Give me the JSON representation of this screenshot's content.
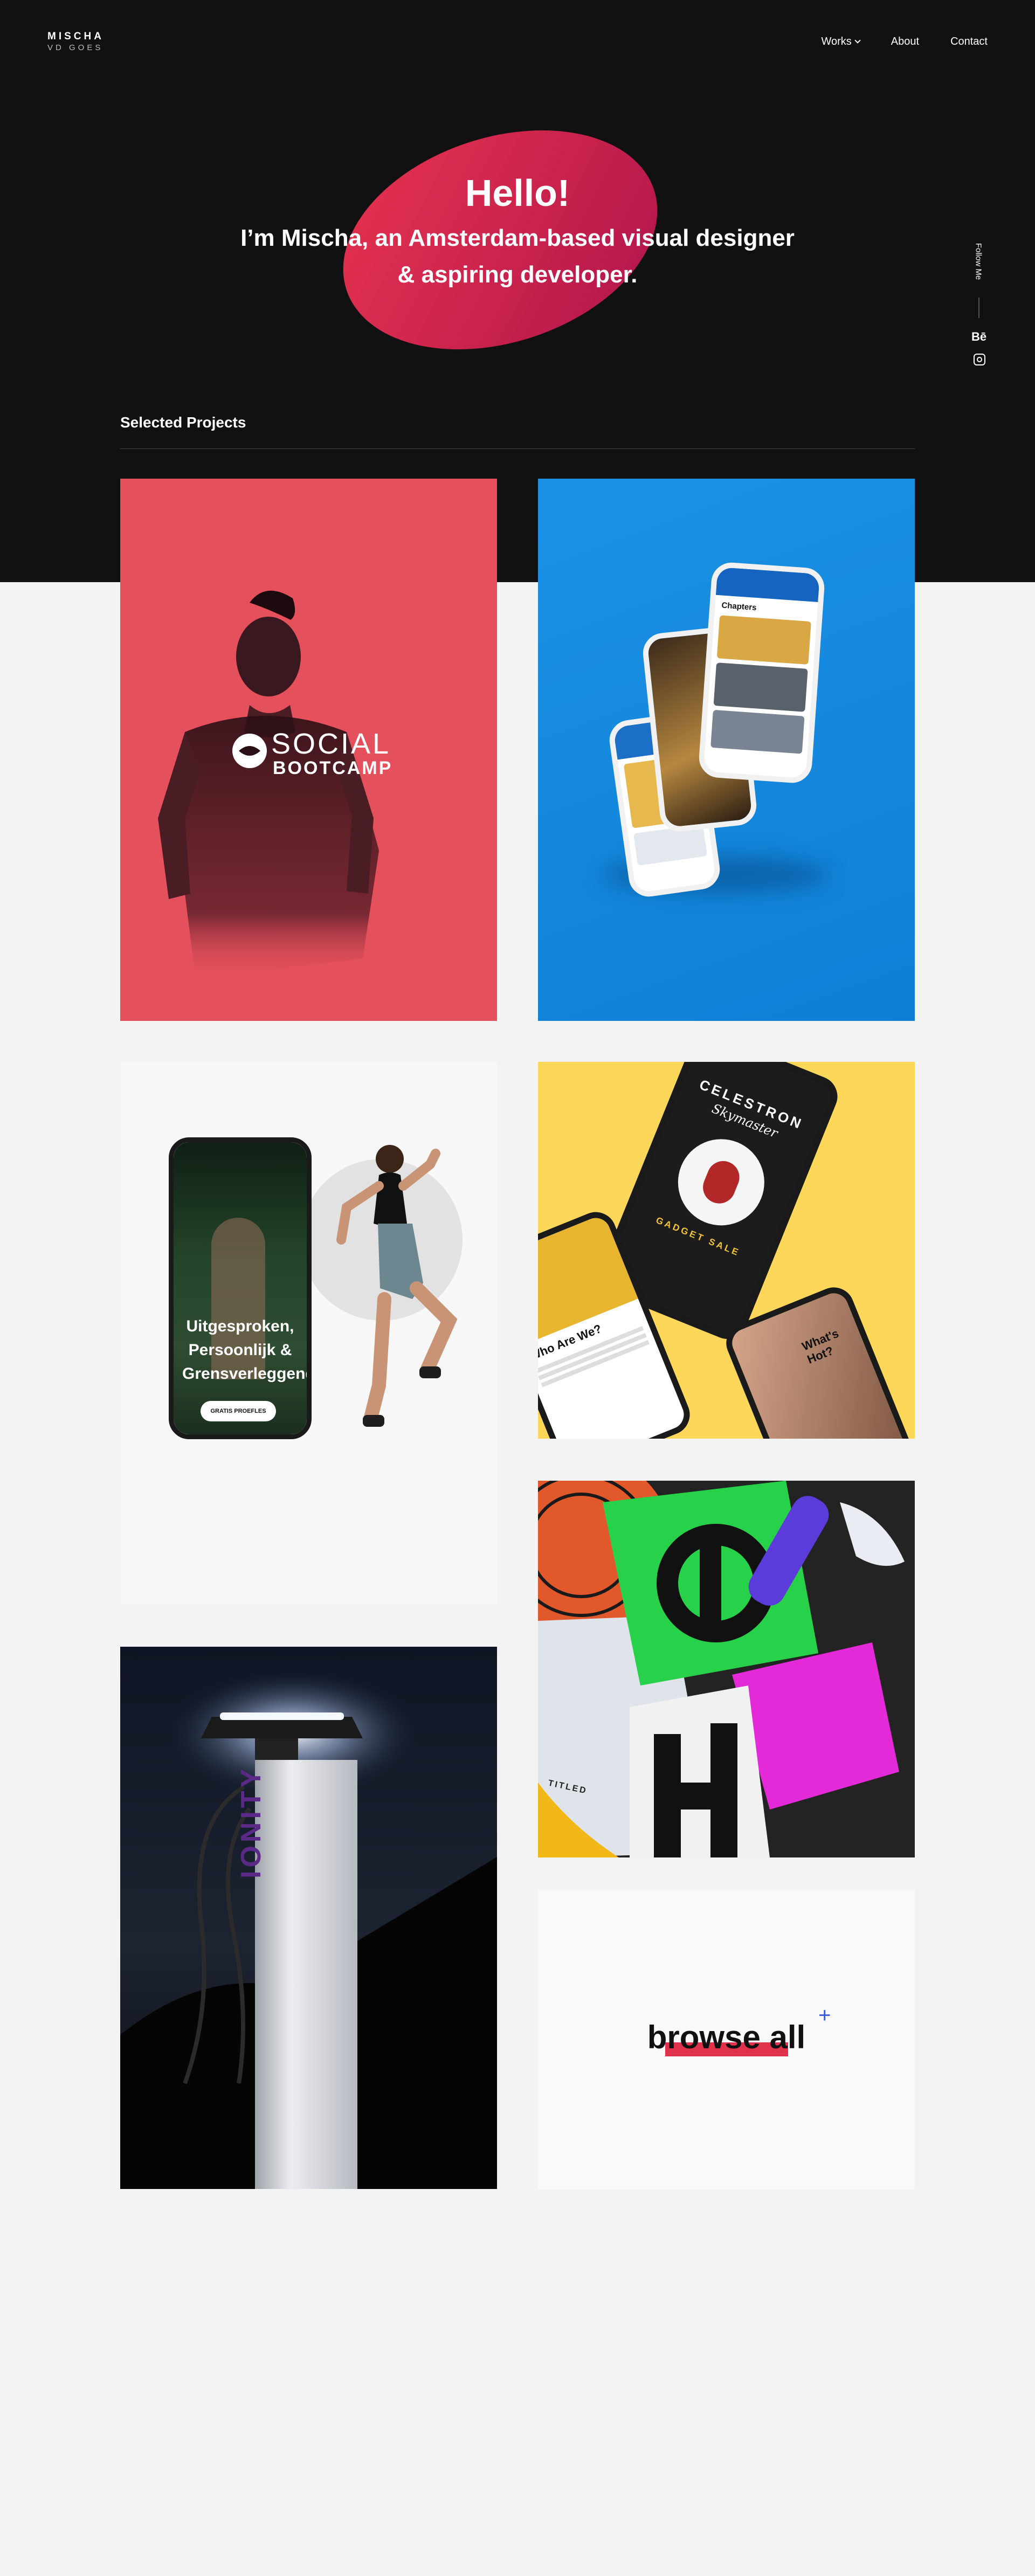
{
  "header": {
    "logo_line1": "MISCHA",
    "logo_line2": "VD GOES",
    "nav": [
      {
        "label": "Works"
      },
      {
        "label": "About"
      },
      {
        "label": "Contact"
      }
    ]
  },
  "hero": {
    "title": "Hello!",
    "subtitle_line1": "I’m Mischa, an Amsterdam-based visual designer",
    "subtitle_line2": "& aspiring developer."
  },
  "social": {
    "follow_label": "Follow Me",
    "behance_label": "Bē"
  },
  "projects": {
    "section_title": "Selected Projects",
    "items": [
      {
        "title": "SOCIAL",
        "subtitle": "BOOTCAMP"
      },
      {
        "title": "Chapters"
      },
      {
        "title": "Uitgesproken, Persoonlijk & Grensverleggend",
        "cta": "GRATIS PROEFLES"
      },
      {
        "title": "CELESTRON",
        "subtitle": "Skymaster",
        "tag": "GADGET SALE",
        "side": "Who Are We?",
        "side2": "What's Hot?"
      },
      {
        "title": "TITLED"
      },
      {
        "title": "IONITY"
      }
    ],
    "browse_label": "browse all"
  },
  "colors": {
    "hero_bg": "#111111",
    "accent": "#e1324d",
    "plus": "#3a5bd8"
  }
}
